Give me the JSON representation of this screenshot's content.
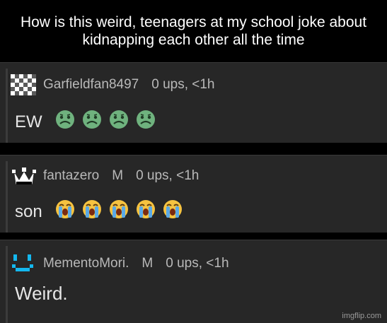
{
  "caption": "How is this weird, teenagers at my school joke about kidnapping each other all the time",
  "comments": [
    {
      "avatar": "checkerboard-icon",
      "username": "Garfieldfan8497",
      "rank": "",
      "ups": "0 ups, <1h",
      "body": "EW",
      "emoji": "nauseated-face-icon",
      "emoji_count": 4
    },
    {
      "avatar": "crown-icon",
      "username": "fantazero",
      "rank": "M",
      "ups": "0 ups, <1h",
      "body": "son",
      "emoji": "loudly-crying-face-icon",
      "emoji_count": 5
    },
    {
      "avatar": "smiley-pixel-icon",
      "username": "MementoMori.",
      "rank": "M",
      "ups": "0 ups, <1h",
      "body": "Weird.",
      "emoji": "",
      "emoji_count": 0
    }
  ],
  "watermark": "imgflip.com",
  "colors": {
    "background": "#000000",
    "comment_bg": "#272727",
    "meta_text": "#b9b9b9",
    "body_text": "#e6e6e6",
    "avatar_cyan": "#14b8ef"
  }
}
